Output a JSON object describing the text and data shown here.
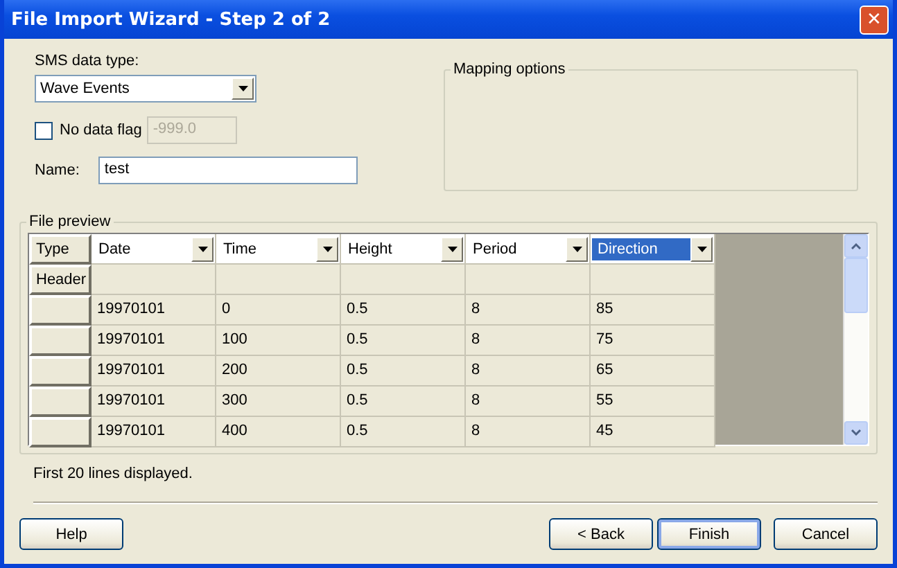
{
  "window": {
    "title": "File Import Wizard - Step 2 of 2",
    "close_symbol": "✕"
  },
  "data_type": {
    "label": "SMS data type:",
    "value": "Wave Events"
  },
  "no_data_flag": {
    "label": "No data flag",
    "checked": false,
    "value": "-999.0",
    "disabled": true
  },
  "name": {
    "label": "Name:",
    "value": "test"
  },
  "mapping_options": {
    "title": "Mapping options"
  },
  "file_preview": {
    "title": "File preview",
    "type_header": "Type",
    "header_row_label": "Header",
    "columns": [
      {
        "label": "Date",
        "selected": false
      },
      {
        "label": "Time",
        "selected": false
      },
      {
        "label": "Height",
        "selected": false
      },
      {
        "label": "Period",
        "selected": false
      },
      {
        "label": "Direction",
        "selected": true
      }
    ],
    "rows": [
      [
        "19970101",
        "0",
        "0.5",
        "8",
        "85"
      ],
      [
        "19970101",
        "100",
        "0.5",
        "8",
        "75"
      ],
      [
        "19970101",
        "200",
        "0.5",
        "8",
        "65"
      ],
      [
        "19970101",
        "300",
        "0.5",
        "8",
        "55"
      ],
      [
        "19970101",
        "400",
        "0.5",
        "8",
        "45"
      ]
    ]
  },
  "status": "First 20 lines displayed.",
  "buttons": [
    {
      "label": "Help",
      "default": false
    },
    {
      "label": "< Back",
      "default": false
    },
    {
      "label": "Finish",
      "default": true
    },
    {
      "label": "Cancel",
      "default": false
    }
  ]
}
